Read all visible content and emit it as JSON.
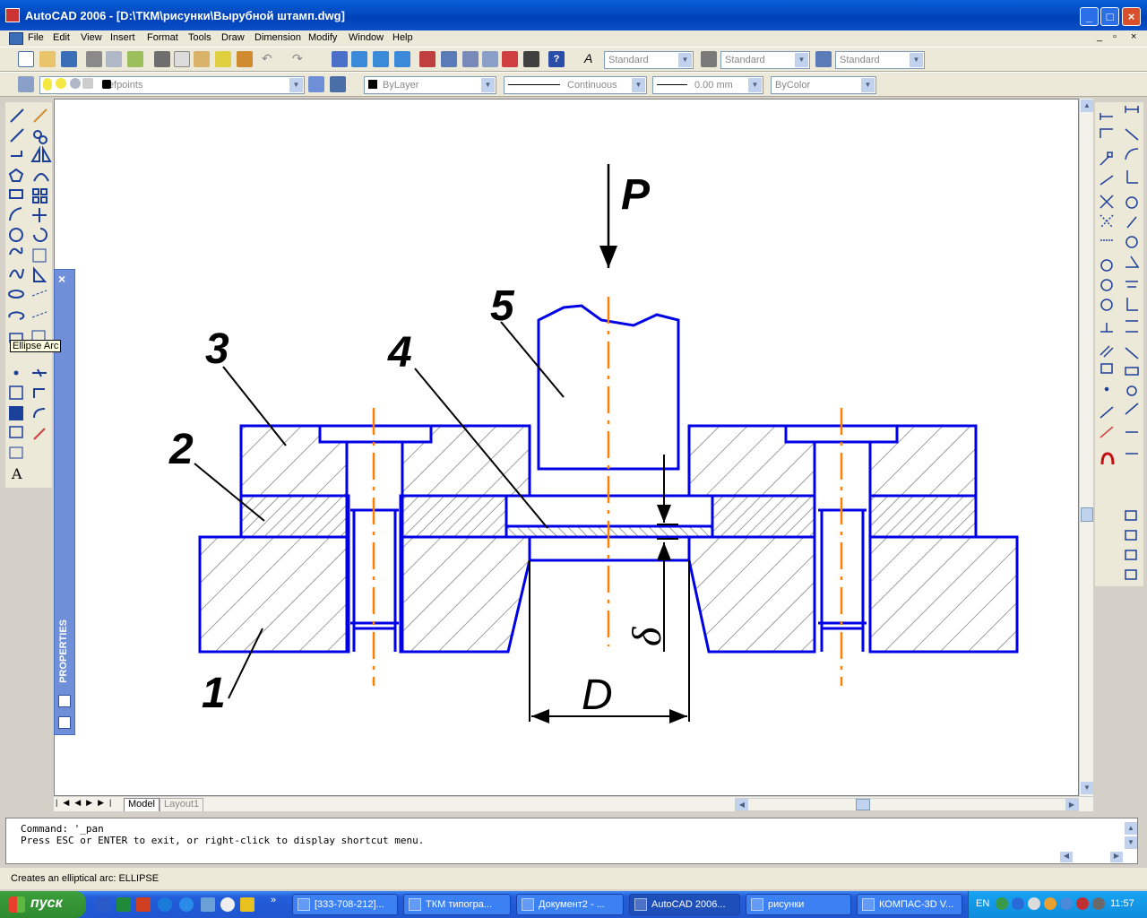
{
  "window": {
    "title": "AutoCAD 2006 - [D:\\ТКМ\\рисунки\\Вырубной штамп.dwg]"
  },
  "menu": [
    "File",
    "Edit",
    "View",
    "Insert",
    "Format",
    "Tools",
    "Draw",
    "Dimension",
    "Modify",
    "Window",
    "Help"
  ],
  "styles_toolbar": {
    "text_style": "Standard",
    "dim_style": "Standard",
    "table_style": "Standard"
  },
  "layers_toolbar": {
    "layer": "Defpoints"
  },
  "properties_toolbar": {
    "color": "ByLayer",
    "linetype": "Continuous",
    "lineweight": "0.00 mm",
    "plotstyle": "ByColor"
  },
  "tooltip": "Ellipse Arc",
  "properties_palette": {
    "label": "PROPERTIES"
  },
  "drawing": {
    "force_label": "P",
    "part_labels": [
      "1",
      "2",
      "3",
      "4",
      "5"
    ],
    "dim_thickness": "δ",
    "dim_diameter": "D",
    "colors": {
      "outline": "#0000e6",
      "centerline": "#ff8000",
      "hatch": "#808080",
      "text": "#000000"
    }
  },
  "layout_tabs": [
    "Model",
    "Layout1"
  ],
  "command": {
    "line1": "Command: '_pan",
    "line2": "Press ESC or ENTER to exit, or right-click to display shortcut menu."
  },
  "status": {
    "message": "Creates an elliptical arc: ELLIPSE"
  },
  "taskbar": {
    "start": "пуск",
    "tasks": [
      "[333-708-212]...",
      "ТКМ типогра...",
      "Документ2 - ...",
      "AutoCAD 2006...",
      "рисунки",
      "КОМПАС-3D V..."
    ],
    "lang": "EN",
    "clock": "11:57"
  }
}
